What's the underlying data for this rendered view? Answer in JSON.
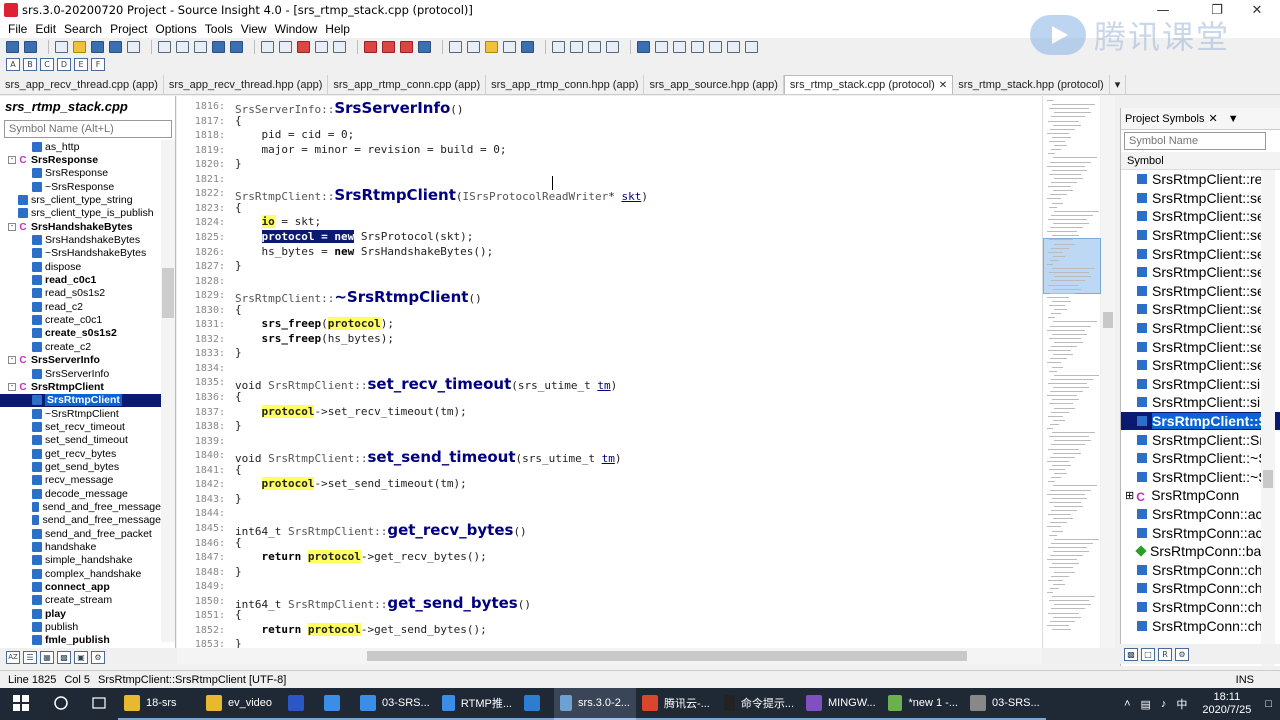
{
  "window": {
    "title": "srs.3.0-20200720 Project - Source Insight 4.0 - [srs_rtmp_stack.cpp (protocol)]"
  },
  "menu": [
    "File",
    "Edit",
    "Search",
    "Project",
    "Options",
    "Tools",
    "View",
    "Window",
    "Help"
  ],
  "logo": {
    "text": "腾讯课堂"
  },
  "tabs": [
    {
      "label": "srs_app_recv_thread.cpp (app)",
      "active": false
    },
    {
      "label": "srs_app_recv_thread.hpp (app)",
      "active": false
    },
    {
      "label": "srs_app_rtmp_conn.cpp (app)",
      "active": false
    },
    {
      "label": "srs_app_rtmp_conn.hpp (app)",
      "active": false
    },
    {
      "label": "srs_app_source.hpp (app)",
      "active": false
    },
    {
      "label": "srs_rtmp_stack.cpp (protocol)",
      "active": true
    },
    {
      "label": "srs_rtmp_stack.hpp (protocol)",
      "active": false
    }
  ],
  "left_panel": {
    "file_title": "srs_rtmp_stack.cpp",
    "search_placeholder": "Symbol Name (Alt+L)",
    "items": [
      {
        "label": "as_http",
        "kind": "m",
        "level": 2,
        "bold": false
      },
      {
        "label": "SrsResponse",
        "kind": "c",
        "level": 1,
        "bold": true,
        "exp": "-"
      },
      {
        "label": "SrsResponse",
        "kind": "m",
        "level": 2,
        "bold": false
      },
      {
        "label": "~SrsResponse",
        "kind": "m",
        "level": 2,
        "bold": false
      },
      {
        "label": "srs_client_type_string",
        "kind": "m",
        "level": 1,
        "bold": false
      },
      {
        "label": "srs_client_type_is_publish",
        "kind": "m",
        "level": 1,
        "bold": false
      },
      {
        "label": "SrsHandshakeBytes",
        "kind": "c",
        "level": 1,
        "bold": true,
        "exp": "-"
      },
      {
        "label": "SrsHandshakeBytes",
        "kind": "m",
        "level": 2,
        "bold": false
      },
      {
        "label": "~SrsHandshakeBytes",
        "kind": "m",
        "level": 2,
        "bold": false
      },
      {
        "label": "dispose",
        "kind": "m",
        "level": 2,
        "bold": false
      },
      {
        "label": "read_c0c1",
        "kind": "m",
        "level": 2,
        "bold": true
      },
      {
        "label": "read_s0s1s2",
        "kind": "m",
        "level": 2,
        "bold": false
      },
      {
        "label": "read_c2",
        "kind": "m",
        "level": 2,
        "bold": false
      },
      {
        "label": "create_c0c1",
        "kind": "m",
        "level": 2,
        "bold": false
      },
      {
        "label": "create_s0s1s2",
        "kind": "m",
        "level": 2,
        "bold": true
      },
      {
        "label": "create_c2",
        "kind": "m",
        "level": 2,
        "bold": false
      },
      {
        "label": "SrsServerInfo",
        "kind": "c",
        "level": 1,
        "bold": true,
        "exp": "-"
      },
      {
        "label": "SrsServerInfo",
        "kind": "m",
        "level": 2,
        "bold": false
      },
      {
        "label": "SrsRtmpClient",
        "kind": "c",
        "level": 1,
        "bold": true,
        "exp": "-"
      },
      {
        "label": "SrsRtmpClient",
        "kind": "m",
        "level": 2,
        "bold": false,
        "selected": true
      },
      {
        "label": "~SrsRtmpClient",
        "kind": "m",
        "level": 2,
        "bold": false
      },
      {
        "label": "set_recv_timeout",
        "kind": "m",
        "level": 2,
        "bold": false
      },
      {
        "label": "set_send_timeout",
        "kind": "m",
        "level": 2,
        "bold": false
      },
      {
        "label": "get_recv_bytes",
        "kind": "m",
        "level": 2,
        "bold": false
      },
      {
        "label": "get_send_bytes",
        "kind": "m",
        "level": 2,
        "bold": false
      },
      {
        "label": "recv_message",
        "kind": "m",
        "level": 2,
        "bold": false
      },
      {
        "label": "decode_message",
        "kind": "m",
        "level": 2,
        "bold": false
      },
      {
        "label": "send_and_free_message",
        "kind": "m",
        "level": 2,
        "bold": false
      },
      {
        "label": "send_and_free_message",
        "kind": "m",
        "level": 2,
        "bold": false
      },
      {
        "label": "send_and_free_packet",
        "kind": "m",
        "level": 2,
        "bold": false
      },
      {
        "label": "handshake",
        "kind": "m",
        "level": 2,
        "bold": false
      },
      {
        "label": "simple_handshake",
        "kind": "m",
        "level": 2,
        "bold": false
      },
      {
        "label": "complex_handshake",
        "kind": "m",
        "level": 2,
        "bold": false
      },
      {
        "label": "connect_app",
        "kind": "m",
        "level": 2,
        "bold": true
      },
      {
        "label": "create_stream",
        "kind": "m",
        "level": 2,
        "bold": false
      },
      {
        "label": "play",
        "kind": "m",
        "level": 2,
        "bold": true
      },
      {
        "label": "publish",
        "kind": "m",
        "level": 2,
        "bold": false
      },
      {
        "label": "fmle_publish",
        "kind": "m",
        "level": 2,
        "bold": true
      }
    ]
  },
  "editor": {
    "lines": [
      {
        "n": "1816:",
        "html": "<span class=\"cls2\">SrsServerInfo::</span><span class=\"fn\">SrsServerInfo</span>()"
      },
      {
        "n": "1817:",
        "html": "{"
      },
      {
        "n": "1818:",
        "html": "    pid = cid = 0;"
      },
      {
        "n": "1819:",
        "html": "    major = minor = revision = build = 0;"
      },
      {
        "n": "1820:",
        "html": "}"
      },
      {
        "n": "1821:",
        "html": ""
      },
      {
        "n": "1822:",
        "html": "<span class=\"cls2\">SrsRtmpClient::</span><span class=\"fn\">SrsRtmpClient</span>(<span class=\"cls2\">ISrsProtocolReadWriter</span>* <span class=\"blue\"><u>skt</u></span>)"
      },
      {
        "n": "1823:",
        "html": "{"
      },
      {
        "n": "1824:",
        "html": "    <span class=\"hl\">io</span> = skt;"
      },
      {
        "n": "1825:",
        "html": "    <span class=\"sel\">protocol = new</span> SrsProtocol(skt);"
      },
      {
        "n": "1826:",
        "html": "    hs_bytes = <span class=\"kw\">new</span> SrsHandshakeBytes();"
      },
      {
        "n": "1827:",
        "html": "}"
      },
      {
        "n": "1828:",
        "html": ""
      },
      {
        "n": "1829:",
        "html": "<span class=\"cls2\">SrsRtmpClient::</span><span class=\"fn\">~SrsRtmpClient</span>()"
      },
      {
        "n": "1830:",
        "html": "{"
      },
      {
        "n": "1831:",
        "html": "    <span class=\"kw\">srs_freep</span>(<span class=\"hl\">protocol</span>);"
      },
      {
        "n": "1832:",
        "html": "    <span class=\"kw\">srs_freep</span>(hs_bytes);"
      },
      {
        "n": "1833:",
        "html": "}"
      },
      {
        "n": "1834:",
        "html": ""
      },
      {
        "n": "1835:",
        "html": "void <span class=\"cls2\">SrsRtmpClient::</span><span class=\"fn\">set_recv_timeout</span>(srs_utime_t <span class=\"blue\"><u>tm</u></span>)"
      },
      {
        "n": "1836:",
        "html": "{"
      },
      {
        "n": "1837:",
        "html": "    <span class=\"hl\">protocol</span>-&gt;set_recv_timeout(tm);"
      },
      {
        "n": "1838:",
        "html": "}"
      },
      {
        "n": "1839:",
        "html": ""
      },
      {
        "n": "1840:",
        "html": "void <span class=\"cls2\">SrsRtmpClient::</span><span class=\"fn\">set_send_timeout</span>(srs_utime_t <span class=\"blue\"><u>tm</u></span>)"
      },
      {
        "n": "1841:",
        "html": "{"
      },
      {
        "n": "1842:",
        "html": "    <span class=\"hl\">protocol</span>-&gt;set_send_timeout(tm);"
      },
      {
        "n": "1843:",
        "html": "}"
      },
      {
        "n": "1844:",
        "html": ""
      },
      {
        "n": "1845:",
        "html": "int64_t <span class=\"cls2\">SrsRtmpClient::</span><span class=\"fn\">get_recv_bytes</span>()"
      },
      {
        "n": "1846:",
        "html": "{"
      },
      {
        "n": "1847:",
        "html": "    <span class=\"kw\">return</span> <span class=\"hl\">protocol</span>-&gt;get_recv_bytes();"
      },
      {
        "n": "1848:",
        "html": "}"
      },
      {
        "n": "1849:",
        "html": ""
      },
      {
        "n": "1850:",
        "html": "int64_t <span class=\"cls2\">SrsRtmpClient::</span><span class=\"fn\">get_send_bytes</span>()"
      },
      {
        "n": "1851:",
        "html": "{"
      },
      {
        "n": "1852:",
        "html": "    <span class=\"kw\">return</span> <span class=\"hl\">protocol</span>-&gt;get_send_bytes();"
      },
      {
        "n": "1853:",
        "html": "}"
      }
    ]
  },
  "right_panel": {
    "title": "Project Symbols",
    "search_placeholder": "Symbol Name",
    "column": "Symbol",
    "items": [
      {
        "label": "SrsRtmpClient::re",
        "kind": "m"
      },
      {
        "label": "SrsRtmpClient::se",
        "kind": "m"
      },
      {
        "label": "SrsRtmpClient::se",
        "kind": "m"
      },
      {
        "label": "SrsRtmpClient::se",
        "kind": "m"
      },
      {
        "label": "SrsRtmpClient::se",
        "kind": "m"
      },
      {
        "label": "SrsRtmpClient::se",
        "kind": "m"
      },
      {
        "label": "SrsRtmpClient::se",
        "kind": "m"
      },
      {
        "label": "SrsRtmpClient::se",
        "kind": "m"
      },
      {
        "label": "SrsRtmpClient::se",
        "kind": "m"
      },
      {
        "label": "SrsRtmpClient::se",
        "kind": "m"
      },
      {
        "label": "SrsRtmpClient::se",
        "kind": "m"
      },
      {
        "label": "SrsRtmpClient::sir",
        "kind": "m"
      },
      {
        "label": "SrsRtmpClient::sir",
        "kind": "m"
      },
      {
        "label": "SrsRtmpClient::Sr",
        "kind": "m",
        "selected": true
      },
      {
        "label": "SrsRtmpClient::Sr",
        "kind": "m"
      },
      {
        "label": "SrsRtmpClient::~S",
        "kind": "m"
      },
      {
        "label": "SrsRtmpClient::~S",
        "kind": "m"
      },
      {
        "label": "SrsRtmpConn",
        "kind": "c"
      },
      {
        "label": "SrsRtmpConn::ac",
        "kind": "m"
      },
      {
        "label": "SrsRtmpConn::ac",
        "kind": "m"
      },
      {
        "label": "SrsRtmpConn::ba",
        "kind": "g"
      },
      {
        "label": "SrsRtmpConn::ch",
        "kind": "m"
      },
      {
        "label": "SrsRtmpConn::ch",
        "kind": "m"
      },
      {
        "label": "SrsRtmpConn::ch",
        "kind": "m"
      },
      {
        "label": "SrsRtmpConn::ch",
        "kind": "m"
      }
    ]
  },
  "status": {
    "line": "Line 1825",
    "col": "Col 5",
    "context": "SrsRtmpClient::SrsRtmpClient [UTF-8]",
    "mode": "INS"
  },
  "taskbar": {
    "items": [
      {
        "label": "18-srs",
        "color": "#e8b830",
        "state": "open"
      },
      {
        "label": "ev_video",
        "color": "#e8b830",
        "state": "open"
      },
      {
        "label": "",
        "color": "#2b57c6",
        "state": "open"
      },
      {
        "label": "",
        "color": "#3a8ee8",
        "state": "open"
      },
      {
        "label": "03-SRS...",
        "color": "#3a8ee8",
        "state": "open"
      },
      {
        "label": "RTMP推...",
        "color": "#3a8ee8",
        "state": "open"
      },
      {
        "label": "",
        "color": "#2d7dd2",
        "state": "open"
      },
      {
        "label": "srs.3.0-2...",
        "color": "#6ea0d0",
        "state": "active"
      },
      {
        "label": "腾讯云-...",
        "color": "#d8462b",
        "state": "open"
      },
      {
        "label": "命令提示...",
        "color": "#222222",
        "state": "open"
      },
      {
        "label": "MINGW...",
        "color": "#8050c0",
        "state": "open"
      },
      {
        "label": "*new 1 -...",
        "color": "#6ab04c",
        "state": "open"
      },
      {
        "label": "03-SRS...",
        "color": "#888888",
        "state": "open"
      }
    ],
    "time": "18:11",
    "date": "2020/7/25"
  },
  "colors": {
    "selection": "#0a64d6",
    "highlight": "#ffff60",
    "taskbar": "#1f2936"
  }
}
